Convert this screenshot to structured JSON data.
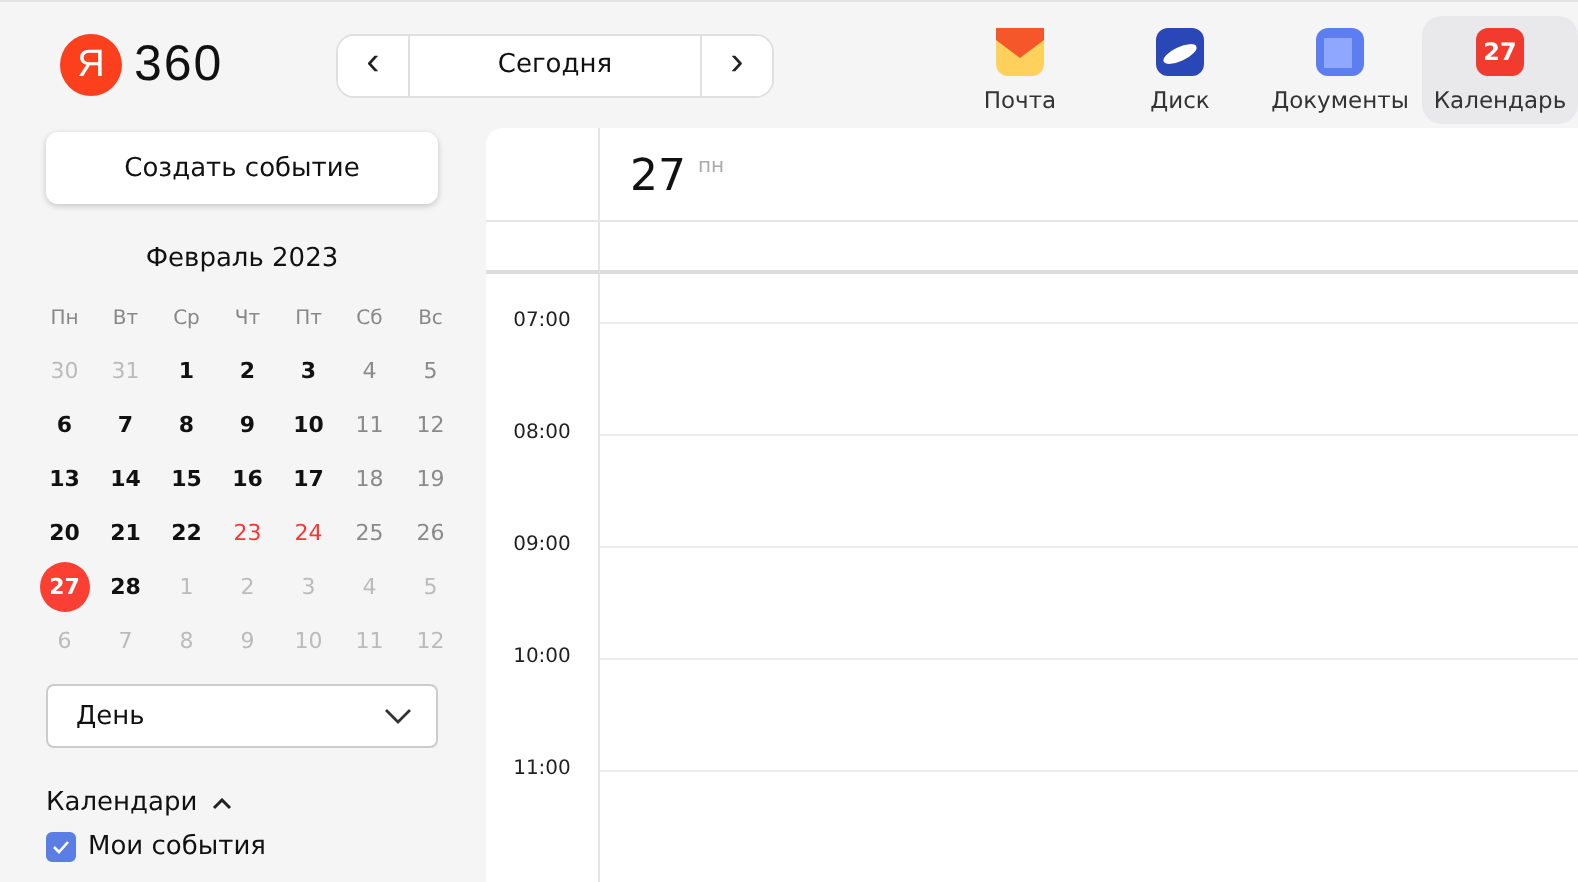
{
  "logo": {
    "letter": "Я",
    "text": "360"
  },
  "nav": {
    "prev": "‹",
    "label": "Сегодня",
    "next": "›"
  },
  "apps": [
    {
      "label": "Почта",
      "kind": "mail",
      "selected": false
    },
    {
      "label": "Диск",
      "kind": "disk",
      "selected": false
    },
    {
      "label": "Документы",
      "kind": "docs",
      "selected": false
    },
    {
      "label": "Календарь",
      "kind": "calendar",
      "badge": "27",
      "selected": true
    }
  ],
  "create_button": "Создать событие",
  "mini_calendar": {
    "title": "Февраль 2023",
    "weekdays": [
      "Пн",
      "Вт",
      "Ср",
      "Чт",
      "Пт",
      "Сб",
      "Вс"
    ],
    "weeks": [
      [
        {
          "d": "30",
          "kind": "other",
          "selected": false
        },
        {
          "d": "31",
          "kind": "other",
          "selected": false
        },
        {
          "d": "1",
          "kind": "work",
          "selected": false
        },
        {
          "d": "2",
          "kind": "work",
          "selected": false
        },
        {
          "d": "3",
          "kind": "work",
          "selected": false
        },
        {
          "d": "4",
          "kind": "weekend",
          "selected": false
        },
        {
          "d": "5",
          "kind": "weekend",
          "selected": false
        }
      ],
      [
        {
          "d": "6",
          "kind": "work",
          "selected": false
        },
        {
          "d": "7",
          "kind": "work",
          "selected": false
        },
        {
          "d": "8",
          "kind": "work",
          "selected": false
        },
        {
          "d": "9",
          "kind": "work",
          "selected": false
        },
        {
          "d": "10",
          "kind": "work",
          "selected": false
        },
        {
          "d": "11",
          "kind": "weekend",
          "selected": false
        },
        {
          "d": "12",
          "kind": "weekend",
          "selected": false
        }
      ],
      [
        {
          "d": "13",
          "kind": "work",
          "selected": false
        },
        {
          "d": "14",
          "kind": "work",
          "selected": false
        },
        {
          "d": "15",
          "kind": "work",
          "selected": false
        },
        {
          "d": "16",
          "kind": "work",
          "selected": false
        },
        {
          "d": "17",
          "kind": "work",
          "selected": false
        },
        {
          "d": "18",
          "kind": "weekend",
          "selected": false
        },
        {
          "d": "19",
          "kind": "weekend",
          "selected": false
        }
      ],
      [
        {
          "d": "20",
          "kind": "work",
          "selected": false
        },
        {
          "d": "21",
          "kind": "work",
          "selected": false
        },
        {
          "d": "22",
          "kind": "work",
          "selected": false
        },
        {
          "d": "23",
          "kind": "holiday",
          "selected": false
        },
        {
          "d": "24",
          "kind": "holiday",
          "selected": false
        },
        {
          "d": "25",
          "kind": "weekend",
          "selected": false
        },
        {
          "d": "26",
          "kind": "weekend",
          "selected": false
        }
      ],
      [
        {
          "d": "27",
          "kind": "work",
          "selected": true
        },
        {
          "d": "28",
          "kind": "work",
          "selected": false
        },
        {
          "d": "1",
          "kind": "other",
          "selected": false
        },
        {
          "d": "2",
          "kind": "other",
          "selected": false
        },
        {
          "d": "3",
          "kind": "other",
          "selected": false
        },
        {
          "d": "4",
          "kind": "other",
          "selected": false
        },
        {
          "d": "5",
          "kind": "other",
          "selected": false
        }
      ],
      [
        {
          "d": "6",
          "kind": "other",
          "selected": false
        },
        {
          "d": "7",
          "kind": "other",
          "selected": false
        },
        {
          "d": "8",
          "kind": "other",
          "selected": false
        },
        {
          "d": "9",
          "kind": "other",
          "selected": false
        },
        {
          "d": "10",
          "kind": "other",
          "selected": false
        },
        {
          "d": "11",
          "kind": "other",
          "selected": false
        },
        {
          "d": "12",
          "kind": "other",
          "selected": false
        }
      ]
    ]
  },
  "view_select": {
    "value": "День"
  },
  "calendars": {
    "title": "Календари",
    "expanded": true,
    "items": [
      {
        "label": "Мои события",
        "checked": true
      }
    ]
  },
  "day_view": {
    "day": "27",
    "weekday": "пн",
    "hours": [
      "07:00",
      "08:00",
      "09:00",
      "10:00",
      "11:00"
    ]
  }
}
